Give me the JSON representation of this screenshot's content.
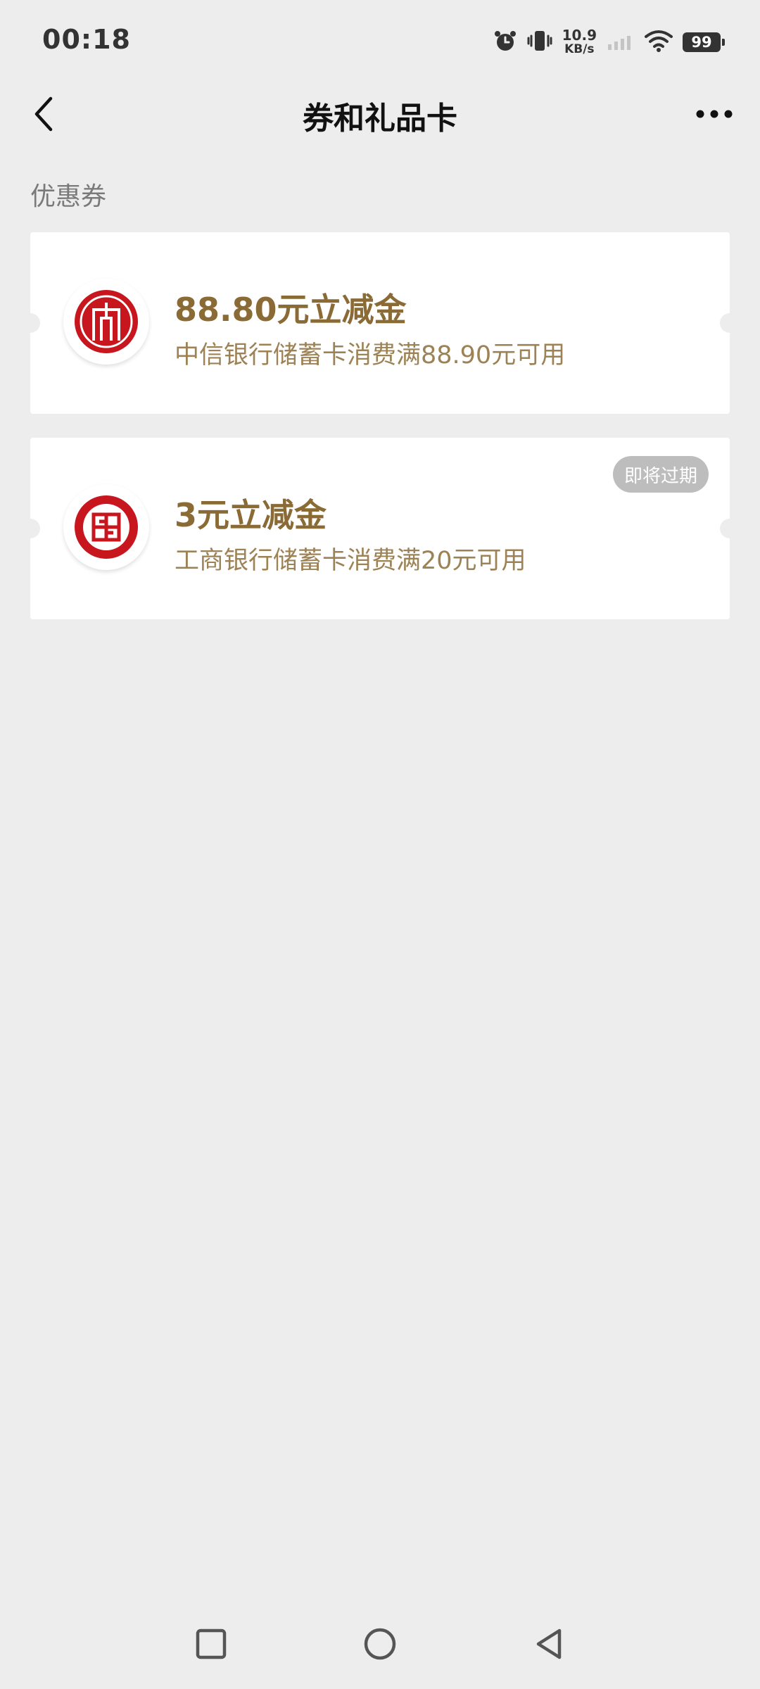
{
  "status_bar": {
    "time": "00:18",
    "net_speed_value": "10.9",
    "net_speed_unit": "KB/s",
    "battery": "99"
  },
  "header": {
    "title": "券和礼品卡"
  },
  "section": {
    "label": "优惠券"
  },
  "coupons": [
    {
      "bank_icon": "citic-bank-logo",
      "title": "88.80元立减金",
      "description": "中信银行储蓄卡消费满88.90元可用",
      "badge": ""
    },
    {
      "bank_icon": "icbc-bank-logo",
      "title": "3元立减金",
      "description": "工商银行储蓄卡消费满20元可用",
      "badge": "即将过期"
    }
  ],
  "colors": {
    "background": "#ededed",
    "card": "#ffffff",
    "coupon_title": "#8a6a35",
    "coupon_desc": "#9c8255",
    "bank_red": "#c7161e",
    "badge_bg": "#bdbdbd"
  }
}
